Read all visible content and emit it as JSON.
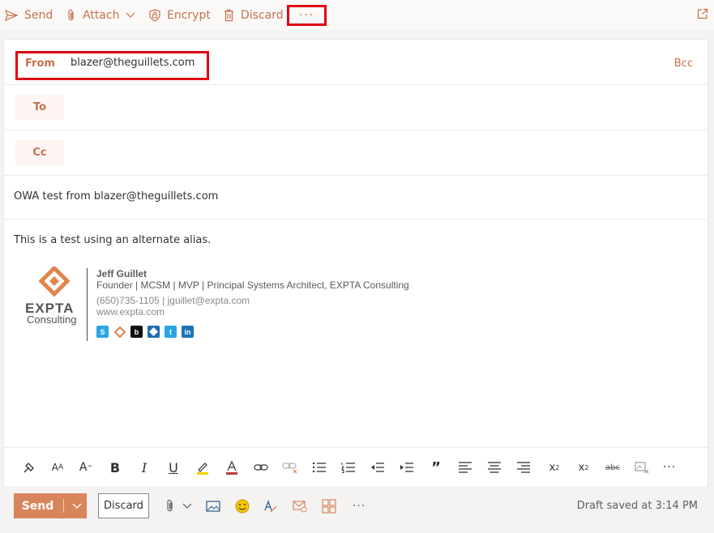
{
  "toolbar": {
    "send_label": "Send",
    "attach_label": "Attach",
    "encrypt_label": "Encrypt",
    "discard_label": "Discard",
    "more_label": "···"
  },
  "compose": {
    "from_label": "From",
    "from_value": "blazer@theguillets.com",
    "bcc_label": "Bcc",
    "to_label": "To",
    "cc_label": "Cc",
    "subject": "OWA test from blazer@theguillets.com",
    "body": "This is a test using an alternate alias."
  },
  "signature": {
    "logo_text": "EXPTA",
    "logo_subtext": "Consulting",
    "name": "Jeff Guillet",
    "title": "Founder | MCSM | MVP | Principal Systems Architect, EXPTA Consulting",
    "contact": "(650)735-1105 | jguillet@expta.com",
    "website": "www.expta.com",
    "social_icons": [
      "skype-icon",
      "expta-icon",
      "blog-icon",
      "mvp-icon",
      "twitter-icon",
      "linkedin-icon"
    ]
  },
  "format_toolbar": {
    "icons": [
      "format-painter-icon",
      "font-size-icon",
      "font-grow-icon",
      "bold-icon",
      "italic-icon",
      "underline-icon",
      "highlight-icon",
      "font-color-icon",
      "link-icon",
      "unlink-icon",
      "bullets-icon",
      "numbering-icon",
      "decrease-indent-icon",
      "increase-indent-icon",
      "quote-icon",
      "align-left-icon",
      "align-center-icon",
      "align-right-icon",
      "superscript-icon",
      "subscript-icon",
      "strikethrough-icon",
      "clear-formatting-icon",
      "more-options-icon"
    ],
    "strike_label": "abc"
  },
  "bottom_bar": {
    "send_label": "Send",
    "discard_label": "Discard",
    "more_label": "···",
    "draft_status": "Draft saved at 3:14 PM"
  },
  "colors": {
    "accent": "#c8704b",
    "send_button": "#d9855c",
    "annotation": "#e00012"
  }
}
